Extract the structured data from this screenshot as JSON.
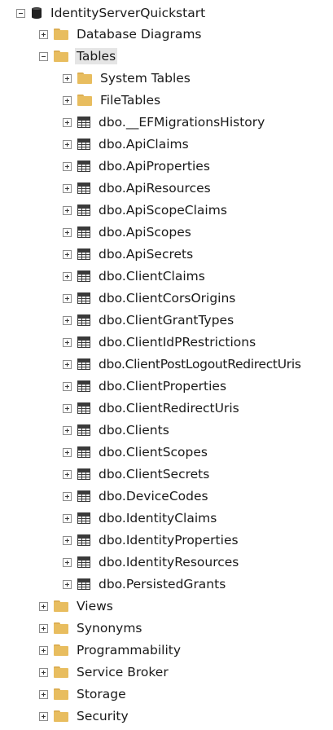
{
  "database": {
    "name": "IdentityServerQuickstart",
    "icon": "database-icon"
  },
  "folders": {
    "database_diagrams": "Database Diagrams",
    "tables": "Tables",
    "system_tables": "System Tables",
    "file_tables": "FileTables",
    "views": "Views",
    "synonyms": "Synonyms",
    "programmability": "Programmability",
    "service_broker": "Service Broker",
    "storage": "Storage",
    "security": "Security"
  },
  "tables": [
    "dbo.__EFMigrationsHistory",
    "dbo.ApiClaims",
    "dbo.ApiProperties",
    "dbo.ApiResources",
    "dbo.ApiScopeClaims",
    "dbo.ApiScopes",
    "dbo.ApiSecrets",
    "dbo.ClientClaims",
    "dbo.ClientCorsOrigins",
    "dbo.ClientGrantTypes",
    "dbo.ClientIdPRestrictions",
    "dbo.ClientPostLogoutRedirectUris",
    "dbo.ClientProperties",
    "dbo.ClientRedirectUris",
    "dbo.Clients",
    "dbo.ClientScopes",
    "dbo.ClientSecrets",
    "dbo.DeviceCodes",
    "dbo.IdentityClaims",
    "dbo.IdentityProperties",
    "dbo.IdentityResources",
    "dbo.PersistedGrants"
  ],
  "colors": {
    "folder": "#e8bd5f",
    "selection": "#e5e5e5",
    "text": "#1a1a1a"
  }
}
